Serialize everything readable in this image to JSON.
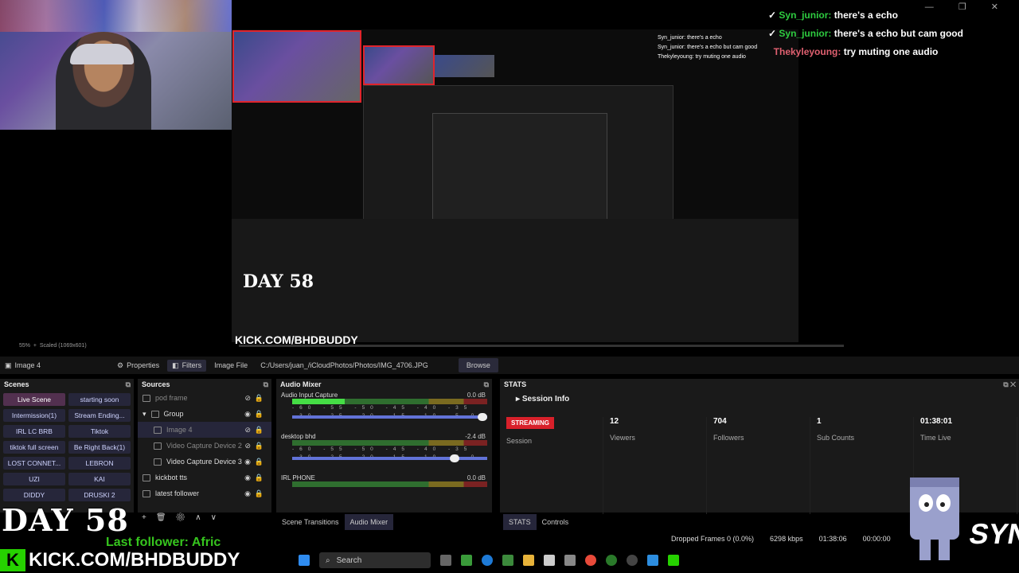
{
  "chat": {
    "messages": [
      {
        "user": "Syn_junior:",
        "text": "there's a echo"
      },
      {
        "user": "Syn_junior:",
        "text": "there's a echo but cam good"
      },
      {
        "user": "Thekyleyoung:",
        "text": "try muting one audio"
      }
    ]
  },
  "preview": {
    "day_label": "DAY 58",
    "kick_label": "KICK.COM/BHDBUDDY",
    "mini_chat": [
      "Syn_junior: there's a echo",
      "Syn_junior: there's a echo but cam good",
      "Thekyleyoung: try muting one audio"
    ]
  },
  "zoombar": {
    "zoom": "55%",
    "scaled": "Scaled (1069x601)"
  },
  "toolbar": {
    "source_name": "Image 4",
    "properties": "Properties",
    "filters": "Filters",
    "image_file_label": "Image File",
    "path": "C:/Users/juan_/iCloudPhotos/Photos/IMG_4706.JPG",
    "browse": "Browse"
  },
  "scenes": {
    "title": "Scenes",
    "items": [
      "Live Scene",
      "starting soon",
      "Intermission(1)",
      "Stream Ending...",
      "IRL LC BRB",
      "Tiktok",
      "tiktok full screen",
      "Be Right Back(1)",
      "LOST CONNET...",
      "LEBRON",
      "UZI",
      "KAI",
      "DIDDY",
      "DRUSKI 2"
    ]
  },
  "sources": {
    "title": "Sources",
    "items": [
      "pod frame",
      "Group",
      "Image 4",
      "Video Capture Device 2",
      "Video Capture Device 3",
      "kickbot tts",
      "latest follower"
    ]
  },
  "mixer": {
    "title": "Audio Mixer",
    "channels": [
      {
        "name": "Audio Input Capture",
        "db": "0.0 dB",
        "level": 0.27,
        "volume": 1.0
      },
      {
        "name": "desktop bhd",
        "db": "-2.4 dB",
        "level": 0.0,
        "volume": 0.85
      },
      {
        "name": "IRL PHONE",
        "db": "0.0 dB",
        "level": 0.0,
        "volume": 1.0
      }
    ],
    "scale": "-60 -55 -50 -45 -40 -35 -30 -25 -20 -15 -10 -5 0"
  },
  "tabs": {
    "scene_transitions": "Scene Transitions",
    "audio_mixer": "Audio Mixer",
    "stats": "STATS",
    "controls": "Controls"
  },
  "stats": {
    "title": "STATS",
    "session_info": "Session Info",
    "streaming": "STREAMING",
    "session": "Session",
    "viewers_v": "12",
    "viewers_l": "Viewers",
    "followers_v": "704",
    "followers_l": "Followers",
    "subs_v": "1",
    "subs_l": "Sub Counts",
    "time_v": "01:38:01",
    "time_l": "Time Live"
  },
  "statusbar": {
    "dropped": "Dropped Frames 0 (0.0%)",
    "kbps": "6298 kbps",
    "time": "01:38:06",
    "rec": "00:00:00"
  },
  "overlay": {
    "day": "DAY 58",
    "follower": "Last follower: Afric",
    "kick": "KICK.COM/BHDBUDDY"
  },
  "taskbar": {
    "search": "Search"
  },
  "colors": {
    "streaming": "#d8202a",
    "accent": "#6273d8",
    "kick_green": "#26d100",
    "chat_user": "#2ecc40"
  }
}
